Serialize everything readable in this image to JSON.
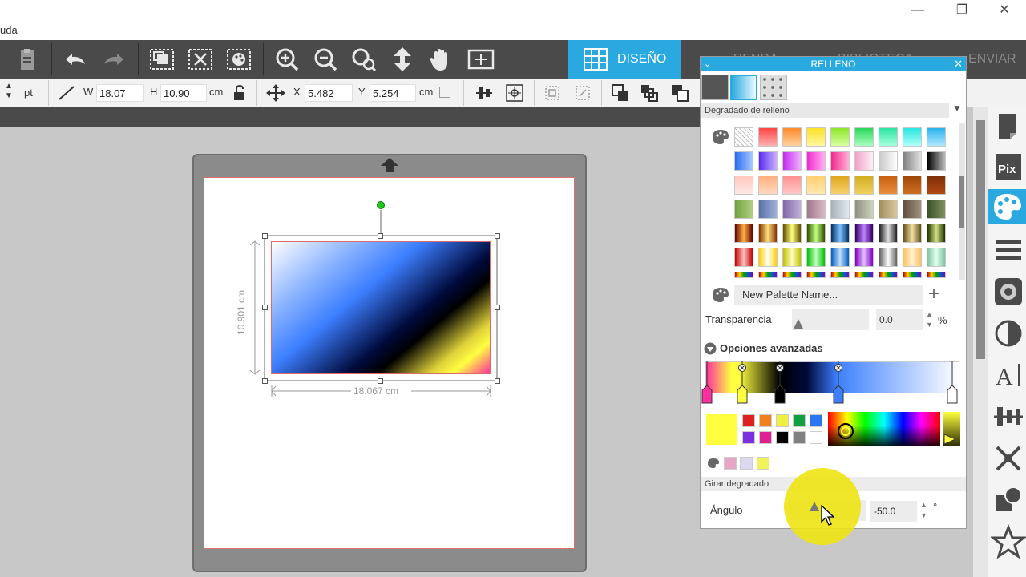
{
  "menu": {
    "partial_text": "uda"
  },
  "window": {
    "minimize": "—",
    "restore": "❐",
    "close": "✕"
  },
  "tabs": {
    "design": "DISEÑO",
    "store_partial": "TIENDA",
    "library_partial": "BIBLIOTECA",
    "send": "ENVIAR"
  },
  "toolbar2": {
    "unit_pt": "pt",
    "w_label": "W",
    "w_value": "18.07",
    "h_label": "H",
    "h_value": "10.90",
    "size_unit": "cm",
    "x_label": "X",
    "x_value": "5.482",
    "y_label": "Y",
    "y_value": "5.254",
    "pos_unit": "cm"
  },
  "canvas": {
    "height_label": "10.901 cm",
    "width_label": "18.067 cm"
  },
  "panel": {
    "title": "RELLENO",
    "section_gradient": "Degradado de relleno",
    "palette_name_placeholder": "New Palette Name...",
    "transparency_label": "Transparencia",
    "transparency_value": "0.0",
    "transparency_unit": "%",
    "advanced_label": "Opciones avanzadas",
    "rotate_section": "Girar degradado",
    "angle_label": "Ángulo",
    "angle_value": "-50.0",
    "angle_unit": "°"
  },
  "colors": {
    "accent": "#29a9e0",
    "toolbar": "#4a4a4a",
    "selected_fill": "#ffff40"
  }
}
